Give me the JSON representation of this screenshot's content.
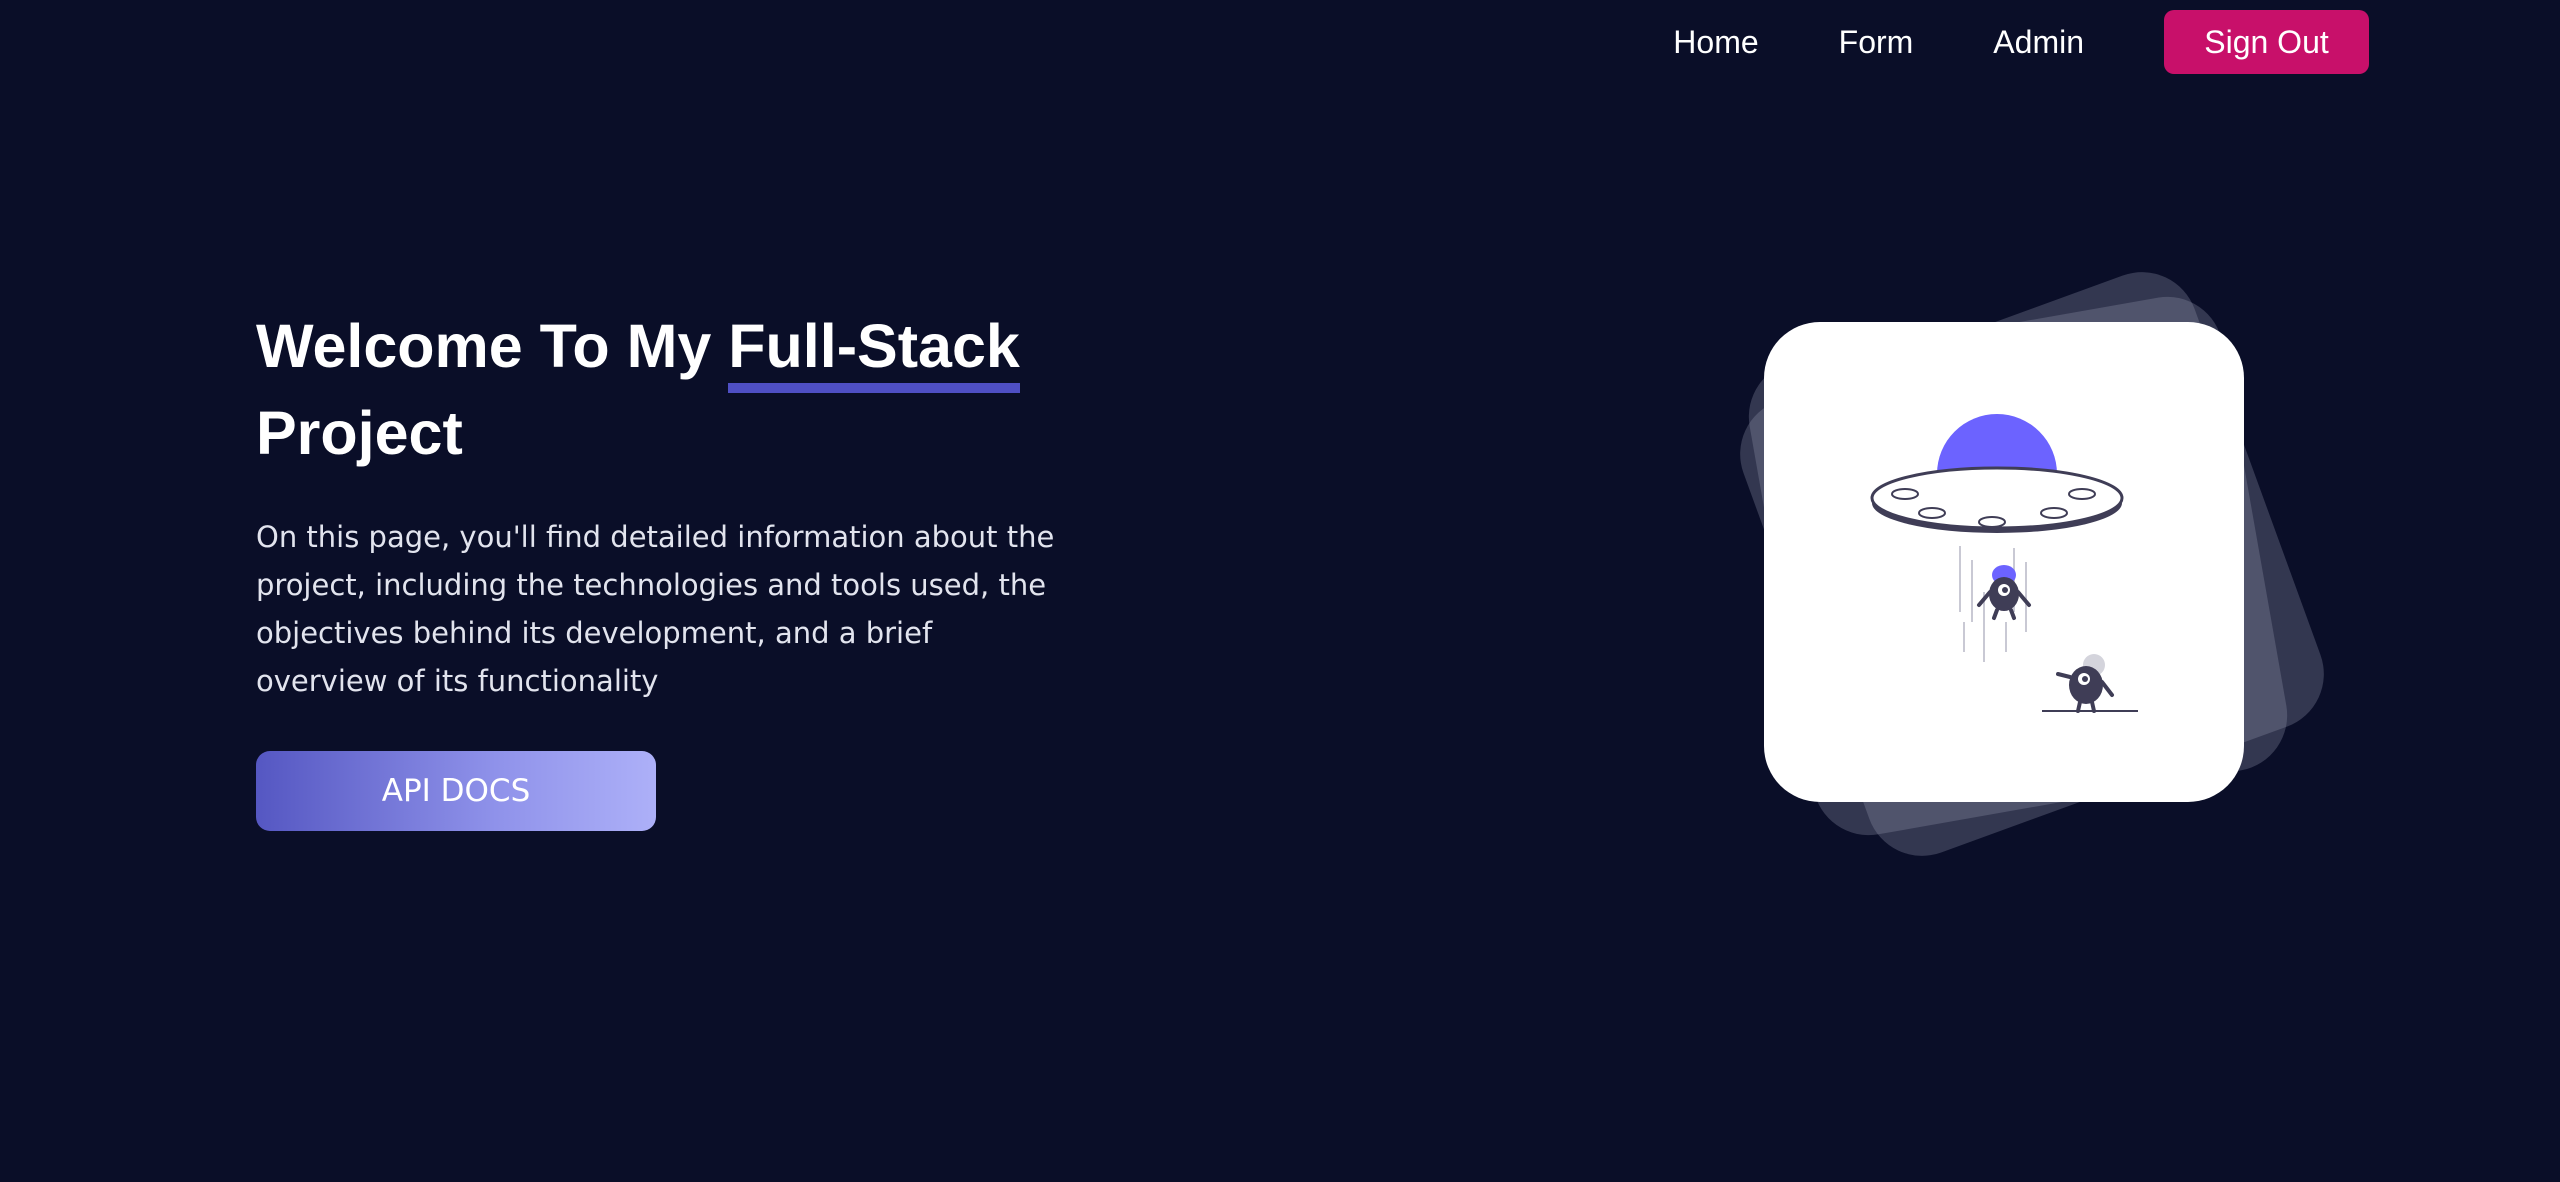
{
  "nav": {
    "links": [
      "Home",
      "Form",
      "Admin"
    ],
    "sign_out_label": "Sign Out"
  },
  "hero": {
    "title_prefix": "Welcome To My ",
    "title_highlight": "Full-Stack",
    "title_suffix": "Project",
    "description": "On this page, you'll find detailed information about the project, including the technologies and tools used, the objectives behind its development, and a brief overview of its functionality",
    "button_label": "API DOCS"
  },
  "colors": {
    "background": "#0a0e28",
    "accent": "#c8106a",
    "underline": "#4f4fc4",
    "illustration_purple": "#6c63ff"
  },
  "illustration": {
    "icon": "ufo-abduction-illustration"
  }
}
